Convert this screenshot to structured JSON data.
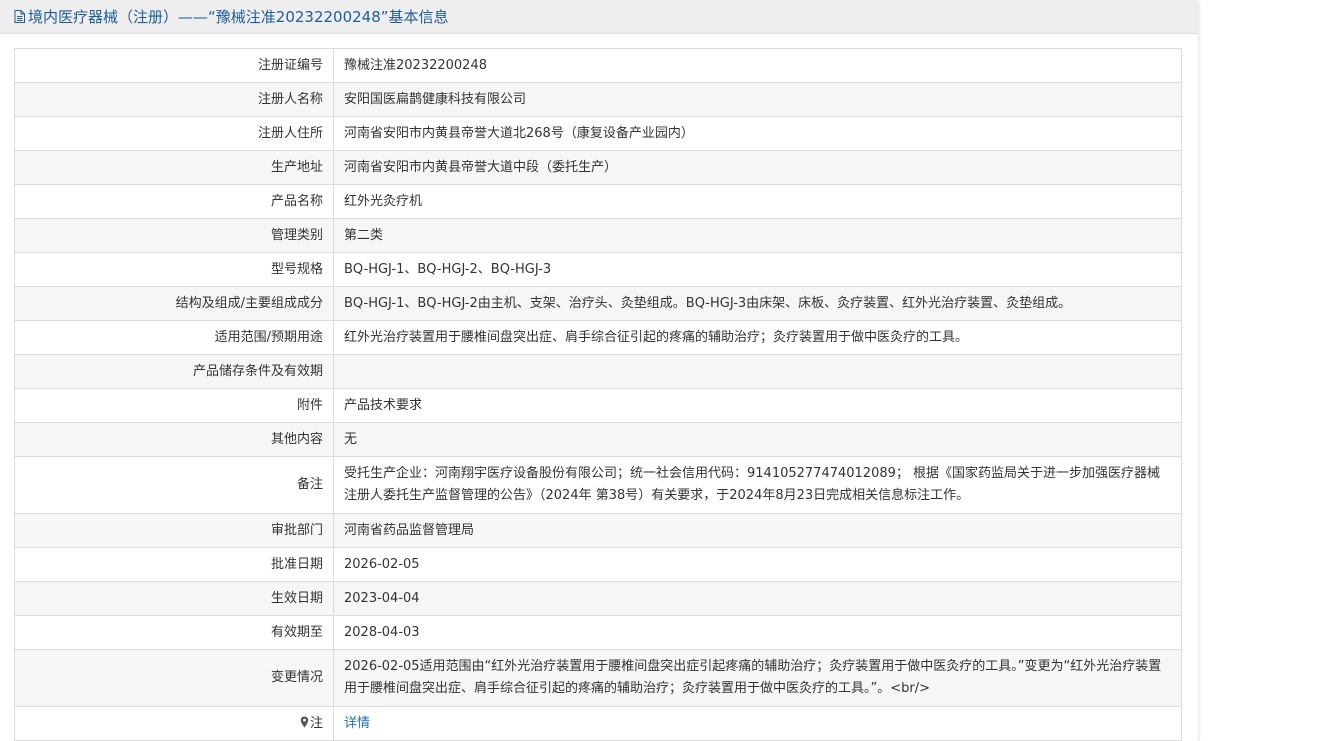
{
  "header": {
    "icon": "document-icon",
    "title": "境内医疗器械（注册）——“豫械注准20232200248”基本信息"
  },
  "rows": [
    {
      "label": "注册证编号",
      "value": "豫械注准20232200248"
    },
    {
      "label": "注册人名称",
      "value": "安阳国医扁鹊健康科技有限公司"
    },
    {
      "label": "注册人住所",
      "value": "河南省安阳市内黄县帝誉大道北268号（康复设备产业园内）"
    },
    {
      "label": "生产地址",
      "value": "河南省安阳市内黄县帝誉大道中段（委托生产）"
    },
    {
      "label": "产品名称",
      "value": "红外光灸疗机"
    },
    {
      "label": "管理类别",
      "value": "第二类"
    },
    {
      "label": "型号规格",
      "value": "BQ-HGJ-1、BQ-HGJ-2、BQ-HGJ-3"
    },
    {
      "label": "结构及组成/主要组成成分",
      "value": "BQ-HGJ-1、BQ-HGJ-2由主机、支架、治疗头、灸垫组成。BQ-HGJ-3由床架、床板、灸疗装置、红外光治疗装置、灸垫组成。"
    },
    {
      "label": "适用范围/预期用途",
      "value": "红外光治疗装置用于腰椎间盘突出症、肩手综合征引起的疼痛的辅助治疗；灸疗装置用于做中医灸疗的工具。"
    },
    {
      "label": "产品储存条件及有效期",
      "value": ""
    },
    {
      "label": "附件",
      "value": "产品技术要求"
    },
    {
      "label": "其他内容",
      "value": "无"
    },
    {
      "label": "备注",
      "value": "受托生产企业：河南翔宇医疗设备股份有限公司；统一社会信用代码：914105277474012089； 根据《国家药监局关于进一步加强医疗器械注册人委托生产监督管理的公告》（2024年 第38号）有关要求，于2024年8月23日完成相关信息标注工作。"
    },
    {
      "label": "审批部门",
      "value": "河南省药品监督管理局"
    },
    {
      "label": "批准日期",
      "value": "2026-02-05"
    },
    {
      "label": "生效日期",
      "value": "2023-04-04"
    },
    {
      "label": "有效期至",
      "value": "2028-04-03"
    },
    {
      "label": "变更情况",
      "value": "2026-02-05适用范围由“红外光治疗装置用于腰椎间盘突出症引起疼痛的辅助治疗；灸疗装置用于做中医灸疗的工具。”变更为“红外光治疗装置用于腰椎间盘突出症、肩手综合征引起的疼痛的辅助治疗；灸疗装置用于做中医灸疗的工具。”。<br/>"
    }
  ],
  "note": {
    "icon": "map-pin-icon",
    "label": "注",
    "link_text": "详情"
  },
  "colors": {
    "title": "#1f5d9c",
    "link": "#1f6fb5",
    "header_bg": "#eeeeee",
    "alt_row_bg": "#f6f6f6",
    "border": "#dcdcdc"
  }
}
